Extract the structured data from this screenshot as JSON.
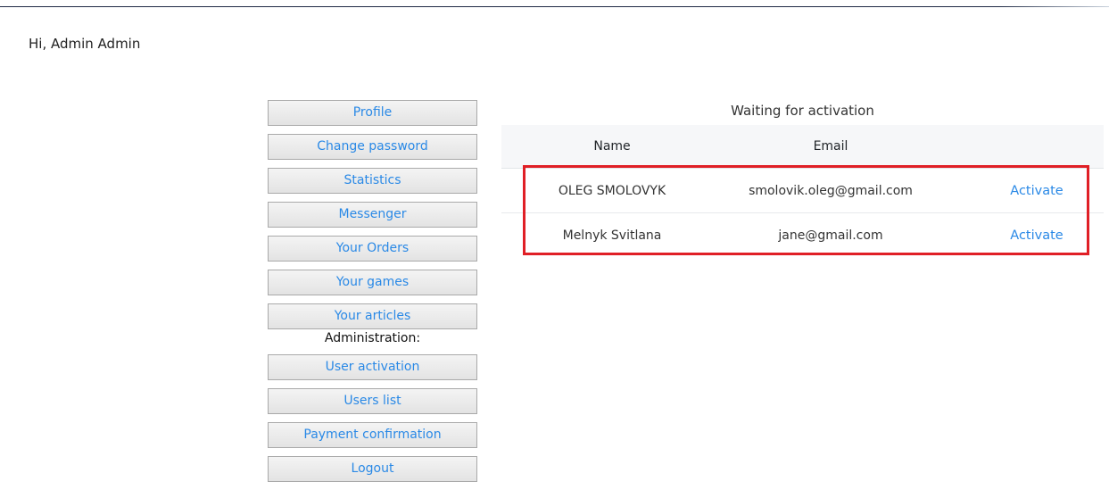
{
  "greeting": "Hi, Admin Admin",
  "menu": {
    "items": [
      "Profile",
      "Change password",
      "Statistics",
      "Messenger",
      "Your Orders",
      "Your games",
      "Your articles"
    ],
    "admin_heading": "Administration:",
    "admin_items": [
      "User activation",
      "Users list",
      "Payment confirmation",
      "Logout"
    ]
  },
  "panel": {
    "title": "Waiting for activation",
    "columns": [
      "Name",
      "Email",
      ""
    ],
    "rows": [
      {
        "name": "OLEG SMOLOVYK",
        "email": "smolovik.oleg@gmail.com",
        "action": "Activate"
      },
      {
        "name": "Melnyk Svitlana",
        "email": "jane@gmail.com",
        "action": "Activate"
      }
    ]
  },
  "colors": {
    "link": "#2a89e6",
    "highlight": "#e01f26"
  }
}
